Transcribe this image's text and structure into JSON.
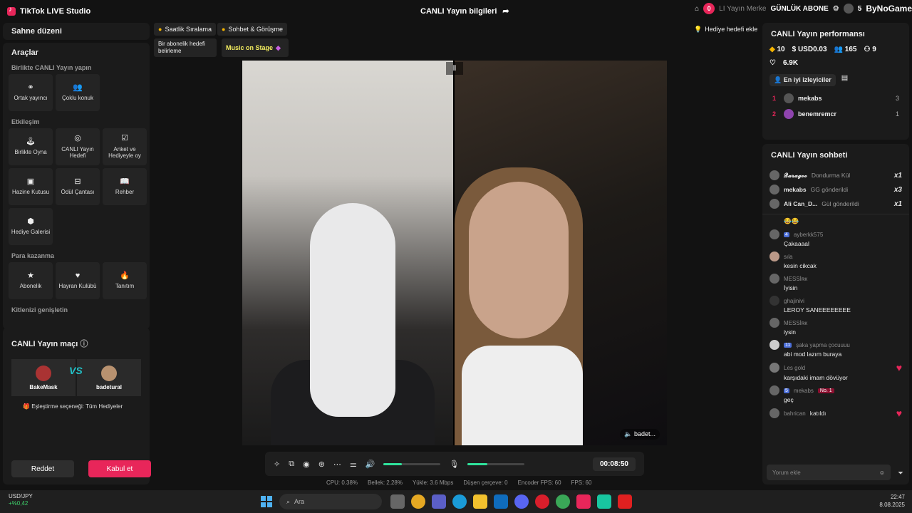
{
  "app": {
    "title": "TikTok LIVE Studio"
  },
  "topbar": {
    "center_title": "CANLI Yayın bilgileri",
    "notif_count": "0",
    "ghost_text": "LI Yayın Merke",
    "right_label": "GÜNLÜK ABONE",
    "right_count": "5",
    "watermark": "ByNoGame"
  },
  "left": {
    "scene": "Sahne düzeni",
    "tools_title": "Araçlar",
    "group1": "Birlikte CANLI Yayın yapın",
    "co_host": "Ortak yayıncı",
    "multi_guest": "Çoklu konuk",
    "group2": "Etkileşim",
    "play_together": "Birlikte Oyna",
    "live_goal": "CANLI Yayın Hedefi",
    "poll": "Anket ve Hediyeyle oy",
    "treasure": "Hazine Kutusu",
    "reward": "Ödül Çantası",
    "guide": "Rehber",
    "gallery": "Hediye Galerisi",
    "group3": "Para kazanma",
    "subscription": "Abonelik",
    "fan_club": "Hayran Kulübü",
    "promote": "Tanıtım",
    "group4": "Kitlenizi genişletin",
    "match_title": "CANLI Yayın maçı",
    "p1": "BakeMask",
    "vs": "VS",
    "p2": "badetural",
    "match_option": "Eşleştirme seçeneği: Tüm Hediyeler",
    "reject": "Reddet",
    "accept": "Kabul et"
  },
  "center": {
    "chip1": "Saatlik Sıralama",
    "chip2": "Sohbet & Görüşme",
    "chip3": "Bir abonelik hedefi belirleme",
    "chip4": "Music on Stage",
    "chip5": "Hediye hedefi ekle",
    "cam_label": "badet...",
    "timer": "00:08:50",
    "mic_level": 0.35,
    "speaker_level": 0.32,
    "stats": {
      "cpu": "CPU: 0.38%",
      "mem": "Bellek: 2.28%",
      "upload": "Yükle: 3.6 Mbps",
      "dropped": "Düşen çerçeve: 0",
      "encoder": "Encoder FPS: 60",
      "fps": "FPS: 60"
    }
  },
  "right": {
    "perf_title": "CANLI Yayın performansı",
    "diamonds": "10",
    "usd": "USD0.03",
    "viewers": "165",
    "new_followers": "9",
    "likes": "6.9K",
    "top_viewers": "En iyi izleyiciler",
    "v1_rank": "1",
    "v1_name": "mekabs",
    "v1_score": "3",
    "v2_rank": "2",
    "v2_name": "benemremcr",
    "v2_score": "1",
    "chat_title": "CANLI Yayın sohbeti",
    "gifts": [
      {
        "name": "𝓠𝓪𝓻𝓪𝓰𝓸𝓸",
        "text": "Dondurma Kül",
        "count": "x1"
      },
      {
        "name": "mekabs",
        "text": "GG gönderildi",
        "count": "x3"
      },
      {
        "name": "Ali Can_D...",
        "text": "Gül gönderildi",
        "count": "x1"
      }
    ],
    "messages": [
      {
        "name": "",
        "level": "",
        "msg": "😂😂"
      },
      {
        "name": "ayberkk575",
        "level": "4",
        "msg": "Çakaaaal"
      },
      {
        "name": "sıla",
        "level": "",
        "msg": "kesin cikcak"
      },
      {
        "name": "MESSİʀᴋ",
        "level": "",
        "msg": "İyisin"
      },
      {
        "name": "ghajinivi",
        "level": "",
        "msg": "LEROY SANEEEEEEEE"
      },
      {
        "name": "MESSİʀᴋ",
        "level": "",
        "msg": "iysin"
      },
      {
        "name": "şaka yapma çocuuuu",
        "level": "11",
        "msg": "abi mod lazım buraya"
      },
      {
        "name": "Les gold",
        "level": "",
        "msg": "karşıdaki imam dövüyor"
      },
      {
        "name": "mekabs",
        "level": "5",
        "msg": "geç",
        "tag": "No. 1"
      }
    ],
    "joined_name": "bahrican",
    "joined_text": "katıldı",
    "input_placeholder": "Yorum ekle"
  },
  "taskbar": {
    "pair": "USD/JPY",
    "change": "+%0,42",
    "search": "Ara",
    "time": "22:47",
    "date": "8.08.2025"
  }
}
